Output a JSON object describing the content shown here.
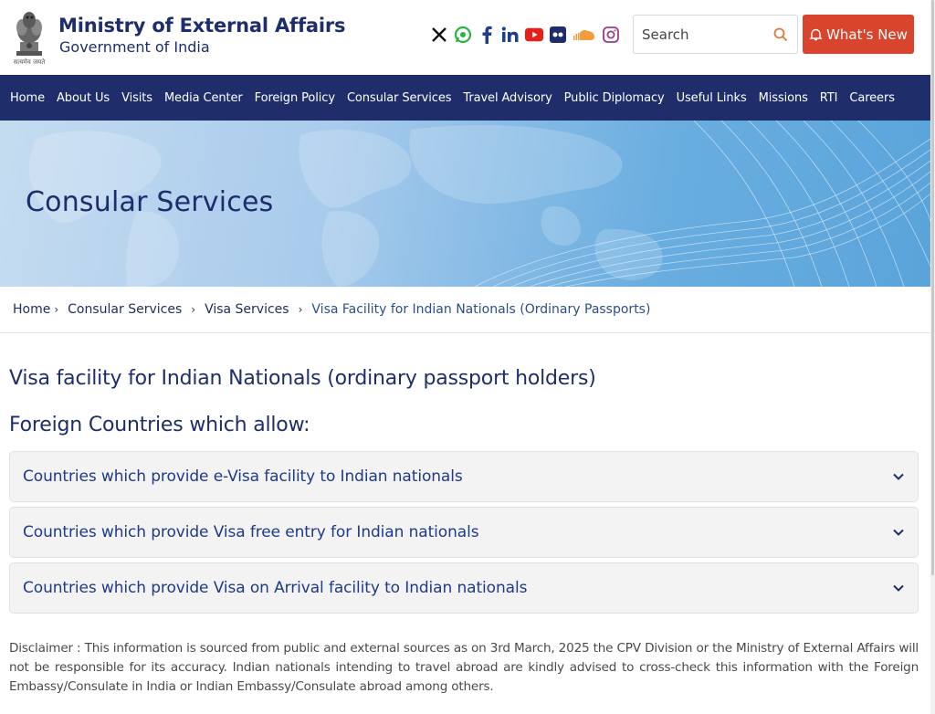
{
  "header": {
    "emblem_caption": "सत्यमेव जयते",
    "title": "Ministry of External Affairs",
    "subtitle": "Government of India",
    "socials": [
      "x-icon",
      "whatsapp-icon",
      "facebook-icon",
      "linkedin-icon",
      "youtube-icon",
      "flickr-icon",
      "soundcloud-icon",
      "instagram-icon"
    ],
    "search_placeholder": "Search",
    "whats_new_label": "What's New",
    "accent_color": "#d9452c"
  },
  "nav": {
    "items": [
      "Home",
      "About Us",
      "Visits",
      "Media Center",
      "Foreign Policy",
      "Consular Services",
      "Travel Advisory",
      "Public Diplomacy",
      "Useful Links",
      "Missions",
      "RTI",
      "Careers"
    ],
    "background": "#1f2d6b"
  },
  "hero": {
    "title": "Consular Services"
  },
  "breadcrumb": {
    "items": [
      "Home",
      "Consular Services",
      "Visa Services"
    ],
    "separator": "›",
    "current": "Visa Facility for Indian Nationals (Ordinary Passports)"
  },
  "main": {
    "page_title": "Visa facility for Indian Nationals (ordinary passport holders)",
    "sub_title": "Foreign Countries which allow:",
    "accordions": [
      "Countries which provide e-Visa facility to Indian nationals",
      "Countries which provide Visa free entry for Indian nationals",
      "Countries which provide Visa on Arrival facility to Indian nationals"
    ],
    "disclaimer": "Disclaimer : This information is sourced from public and external sources as on 3rd March, 2025 the CPV Division or the Ministry of External Affairs will not be responsible for its accuracy. Indian nationals intending to travel abroad are kindly advised to cross-check this information with the Foreign Embassy/Consulate in India or Indian Embassy/Consulate abroad among others."
  }
}
